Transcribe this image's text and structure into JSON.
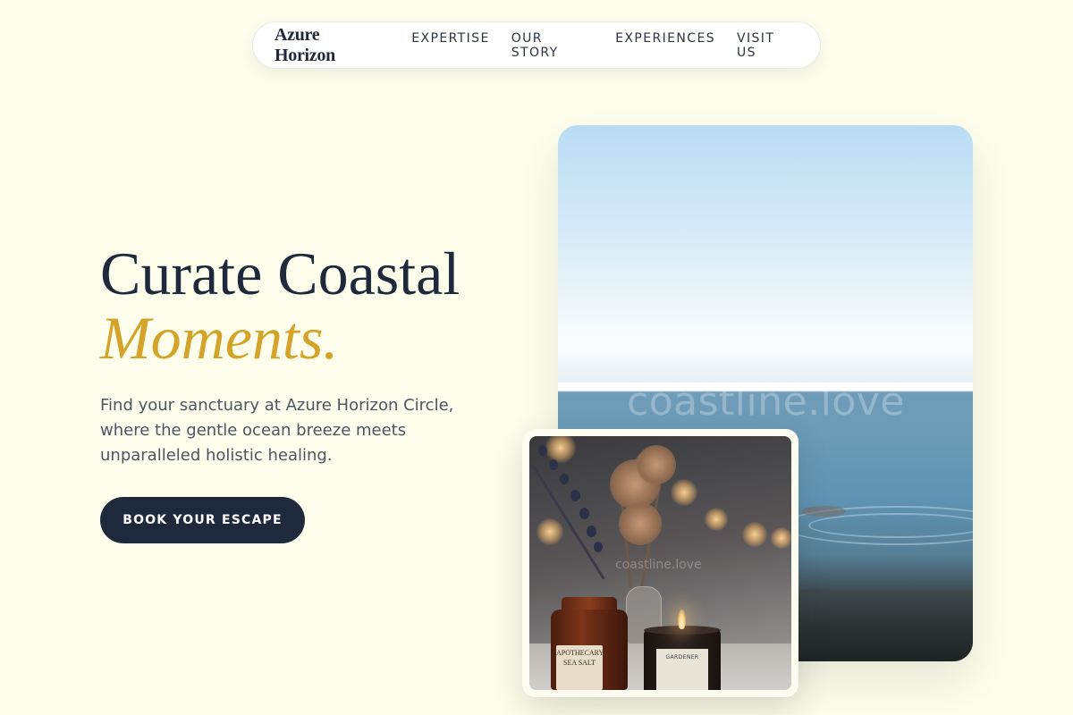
{
  "nav": {
    "brand": "Azure Horizon",
    "links": [
      "EXPERTISE",
      "OUR STORY",
      "EXPERIENCES",
      "VISIT US"
    ]
  },
  "hero": {
    "title_line1": "Curate Coastal",
    "title_line2": "Moments.",
    "description": "Find your sanctuary at Azure Horizon Circle, where the gentle ocean breeze meets unparalleled holistic healing.",
    "cta_label": "BOOK YOUR ESCAPE"
  },
  "images": {
    "main_watermark": "coastline.love",
    "small_watermark": "coastline.love",
    "jar_label": "APOTHECARY SEA SALT",
    "candle_label": "GARDENER"
  },
  "colors": {
    "background": "#fefeec",
    "primary_navy": "#1e2a3c",
    "accent_gold": "#d4a42a",
    "body_text": "#4c5563"
  }
}
